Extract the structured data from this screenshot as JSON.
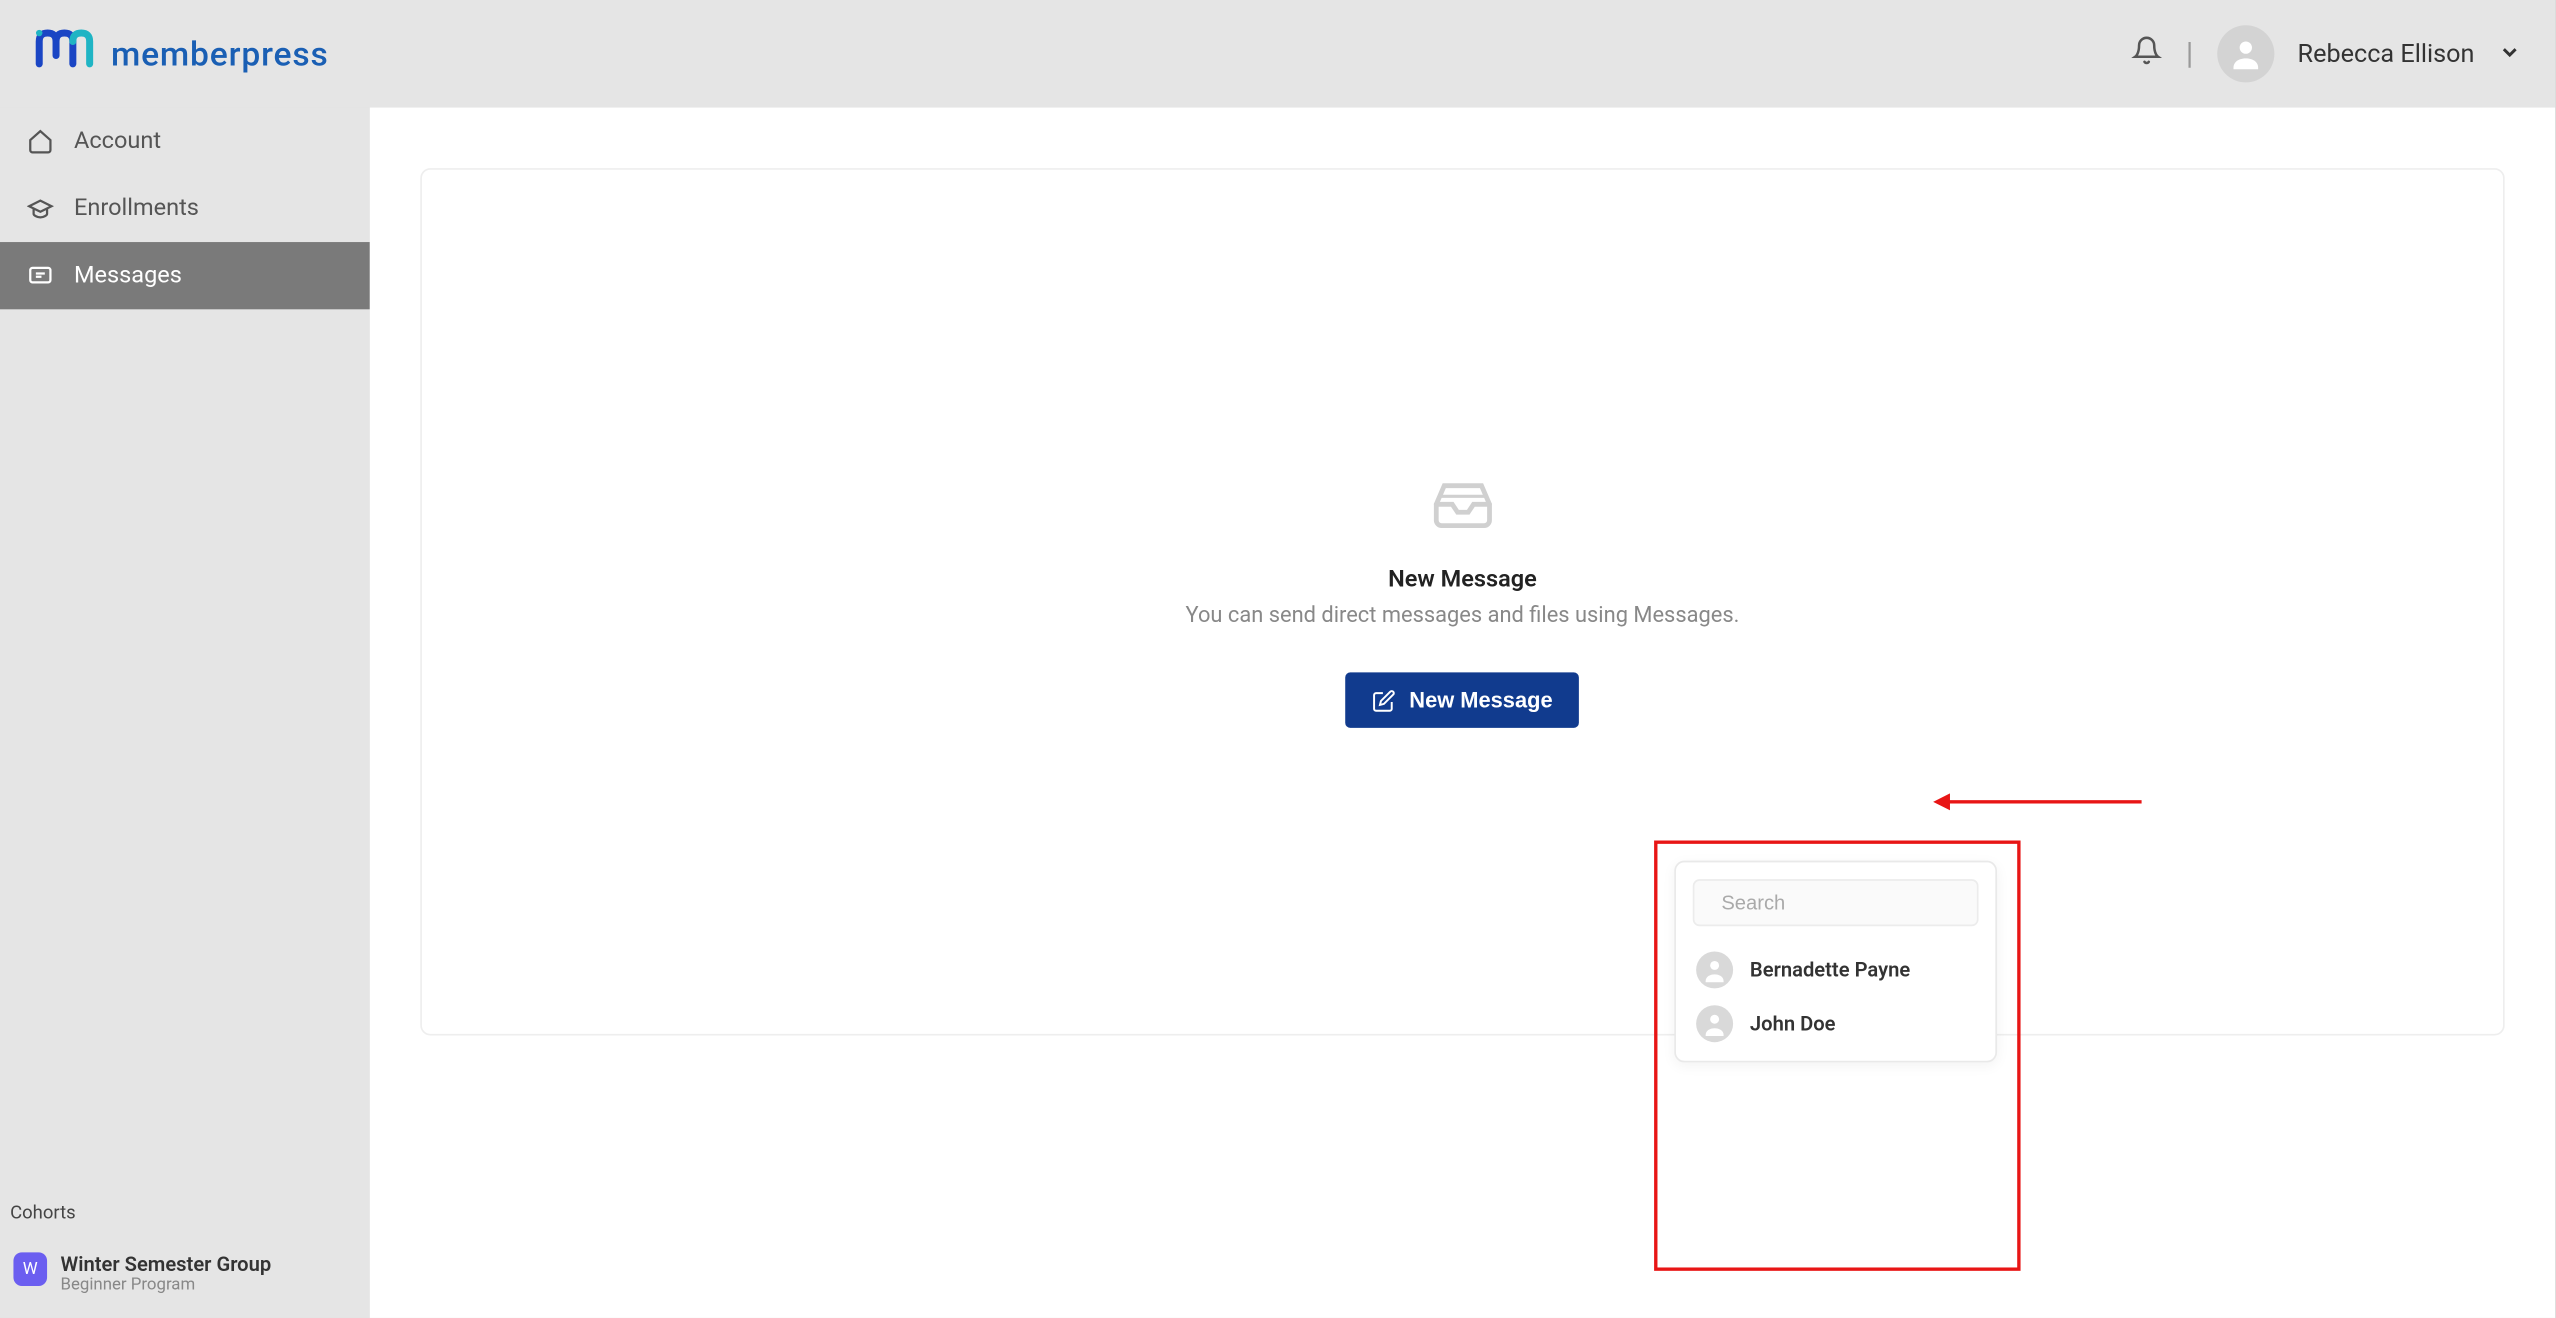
{
  "brand": "memberpress",
  "header": {
    "user_name": "Rebecca Ellison"
  },
  "sidebar": {
    "items": [
      {
        "label": "Account"
      },
      {
        "label": "Enrollments"
      },
      {
        "label": "Messages"
      }
    ],
    "cohorts_label": "Cohorts",
    "cohort": {
      "initial": "W",
      "title": "Winter Semester Group",
      "subtitle": "Beginner Program"
    }
  },
  "empty_state": {
    "title": "New Message",
    "subtitle": "You can send direct messages and files using Messages.",
    "button_label": "New Message"
  },
  "popover": {
    "search_placeholder": "Search",
    "people": [
      {
        "name": "Bernadette Payne"
      },
      {
        "name": "John Doe"
      }
    ]
  }
}
